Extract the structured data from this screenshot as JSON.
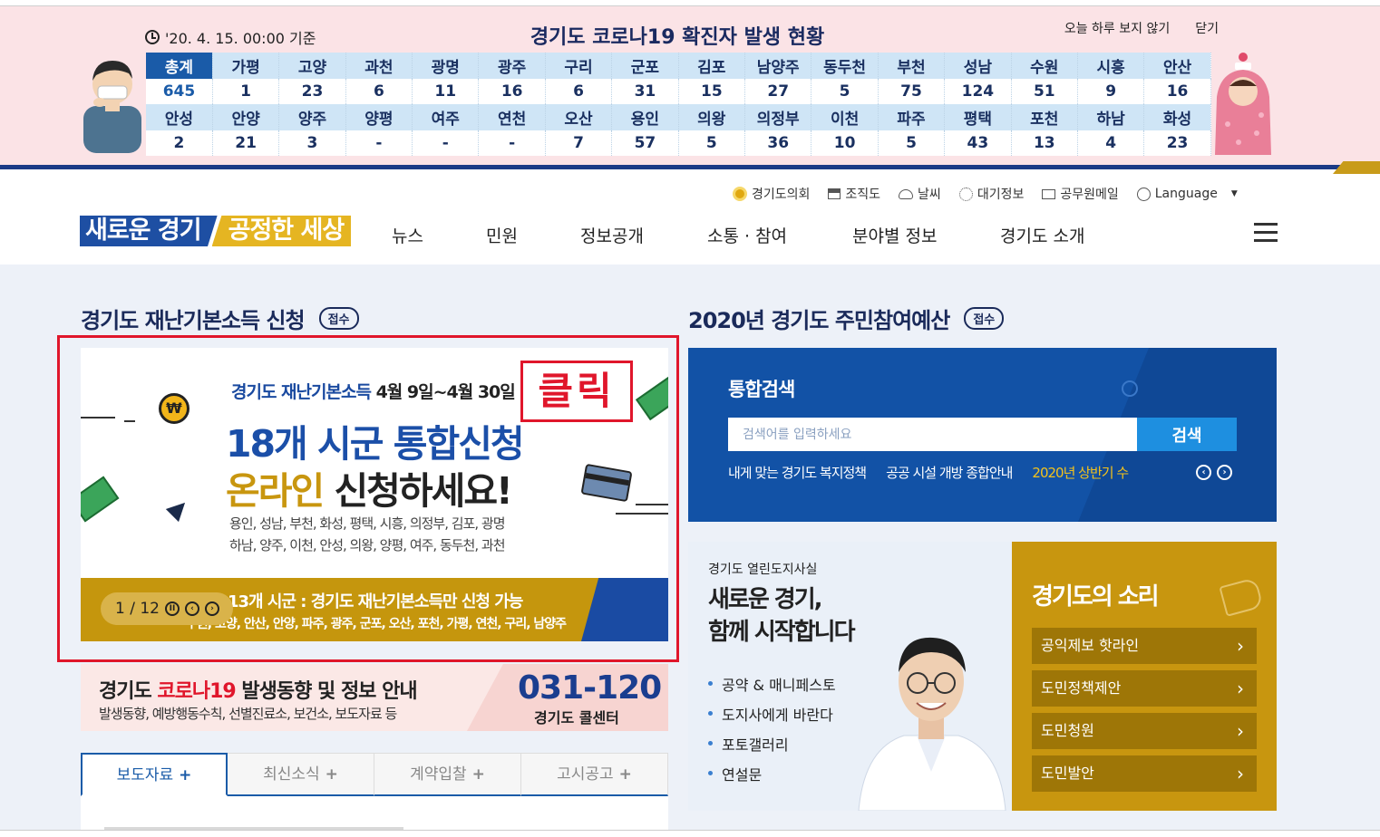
{
  "covid_banner": {
    "time_label": "'20. 4. 15. 00:00 기준",
    "title": "경기도 코로나19 확진자 발생 현황",
    "hide_today": "오늘 하루 보지 않기",
    "close": "닫기",
    "row1_headers": [
      "총계",
      "가평",
      "고양",
      "과천",
      "광명",
      "광주",
      "구리",
      "군포",
      "김포",
      "남양주",
      "동두천",
      "부천",
      "성남",
      "수원",
      "시흥",
      "안산"
    ],
    "row1_values": [
      "645",
      "1",
      "23",
      "6",
      "11",
      "16",
      "6",
      "31",
      "15",
      "27",
      "5",
      "75",
      "124",
      "51",
      "9",
      "16"
    ],
    "row2_headers": [
      "안성",
      "안양",
      "양주",
      "양평",
      "여주",
      "연천",
      "오산",
      "용인",
      "의왕",
      "의정부",
      "이천",
      "파주",
      "평택",
      "포천",
      "하남",
      "화성"
    ],
    "row2_values": [
      "2",
      "21",
      "3",
      "-",
      "-",
      "-",
      "7",
      "57",
      "5",
      "36",
      "10",
      "5",
      "43",
      "13",
      "4",
      "23"
    ]
  },
  "header": {
    "logo_part1": "새로운 경기",
    "logo_part2": "공정한 세상",
    "util_links": [
      "경기도의회",
      "조직도",
      "날씨",
      "대기정보",
      "공무원메일",
      "Language"
    ],
    "gnb": [
      "뉴스",
      "민원",
      "정보공개",
      "소통 · 참여",
      "분야별 정보",
      "경기도 소개"
    ]
  },
  "left_section": {
    "title": "경기도 재난기본소득 신청",
    "badge": "접수",
    "promo": {
      "subtitle_blue": "경기도 재난기본소득",
      "subtitle_date": "4월 9일~4월 30일",
      "headline1": "18개 시군 통합신청",
      "headline2_gold": "온라인",
      "headline2_rest": "신청하세요!",
      "cities_line1": "용인, 성남, 부천, 화성, 평택, 시흥, 의정부, 김포, 광명",
      "cities_line2": "하남, 양주, 이천, 안성, 의왕, 양평, 여주, 동두천, 과천",
      "click_label": "클릭",
      "won_symbol": "₩",
      "bar_line1": "13개 시군 : 경기도 재난기본소득만 신청 가능",
      "bar_line2": "수원, 고양, 안산, 안양, 파주, 광주, 군포, 오산, 포천, 가평, 연천, 구리, 남양주",
      "pager": "1 / 12"
    },
    "corona": {
      "title_prefix": "경기도",
      "title_red": "코로나19",
      "title_suffix": "발생동향 및 정보 안내",
      "desc": "발생동향, 예방행동수칙, 선별진료소, 보건소, 보도자료 등",
      "phone": "031-120",
      "call_center": "경기도 콜센터"
    },
    "tabs": [
      "보도자료",
      "최신소식",
      "계약입찰",
      "고시공고"
    ]
  },
  "right_section": {
    "title": "2020년 경기도 주민참여예산",
    "badge": "접수",
    "search": {
      "title": "통합검색",
      "placeholder": "검색어를 입력하세요",
      "button": "검색",
      "quick_links": [
        "내게 맞는 경기도 복지정책",
        "공공 시설 개방 종합안내"
      ],
      "quick_link_highlight": "2020년 상반기 수"
    },
    "governor": {
      "small": "경기도 열린도지사실",
      "heading_line1": "새로운 경기,",
      "heading_line2": "함께 시작합니다",
      "links": [
        "공약 & 매니페스토",
        "도지사에게 바란다",
        "포토갤러리",
        "연설문"
      ]
    },
    "voice": {
      "title": "경기도의 소리",
      "items": [
        "공익제보 핫라인",
        "도민정책제안",
        "도민청원",
        "도민발안"
      ]
    }
  },
  "colors": {
    "navy": "#1b3b86",
    "blue": "#1252a6",
    "gold": "#c8960f",
    "red": "#e0162b",
    "banner_pink": "#fbe3e6"
  }
}
